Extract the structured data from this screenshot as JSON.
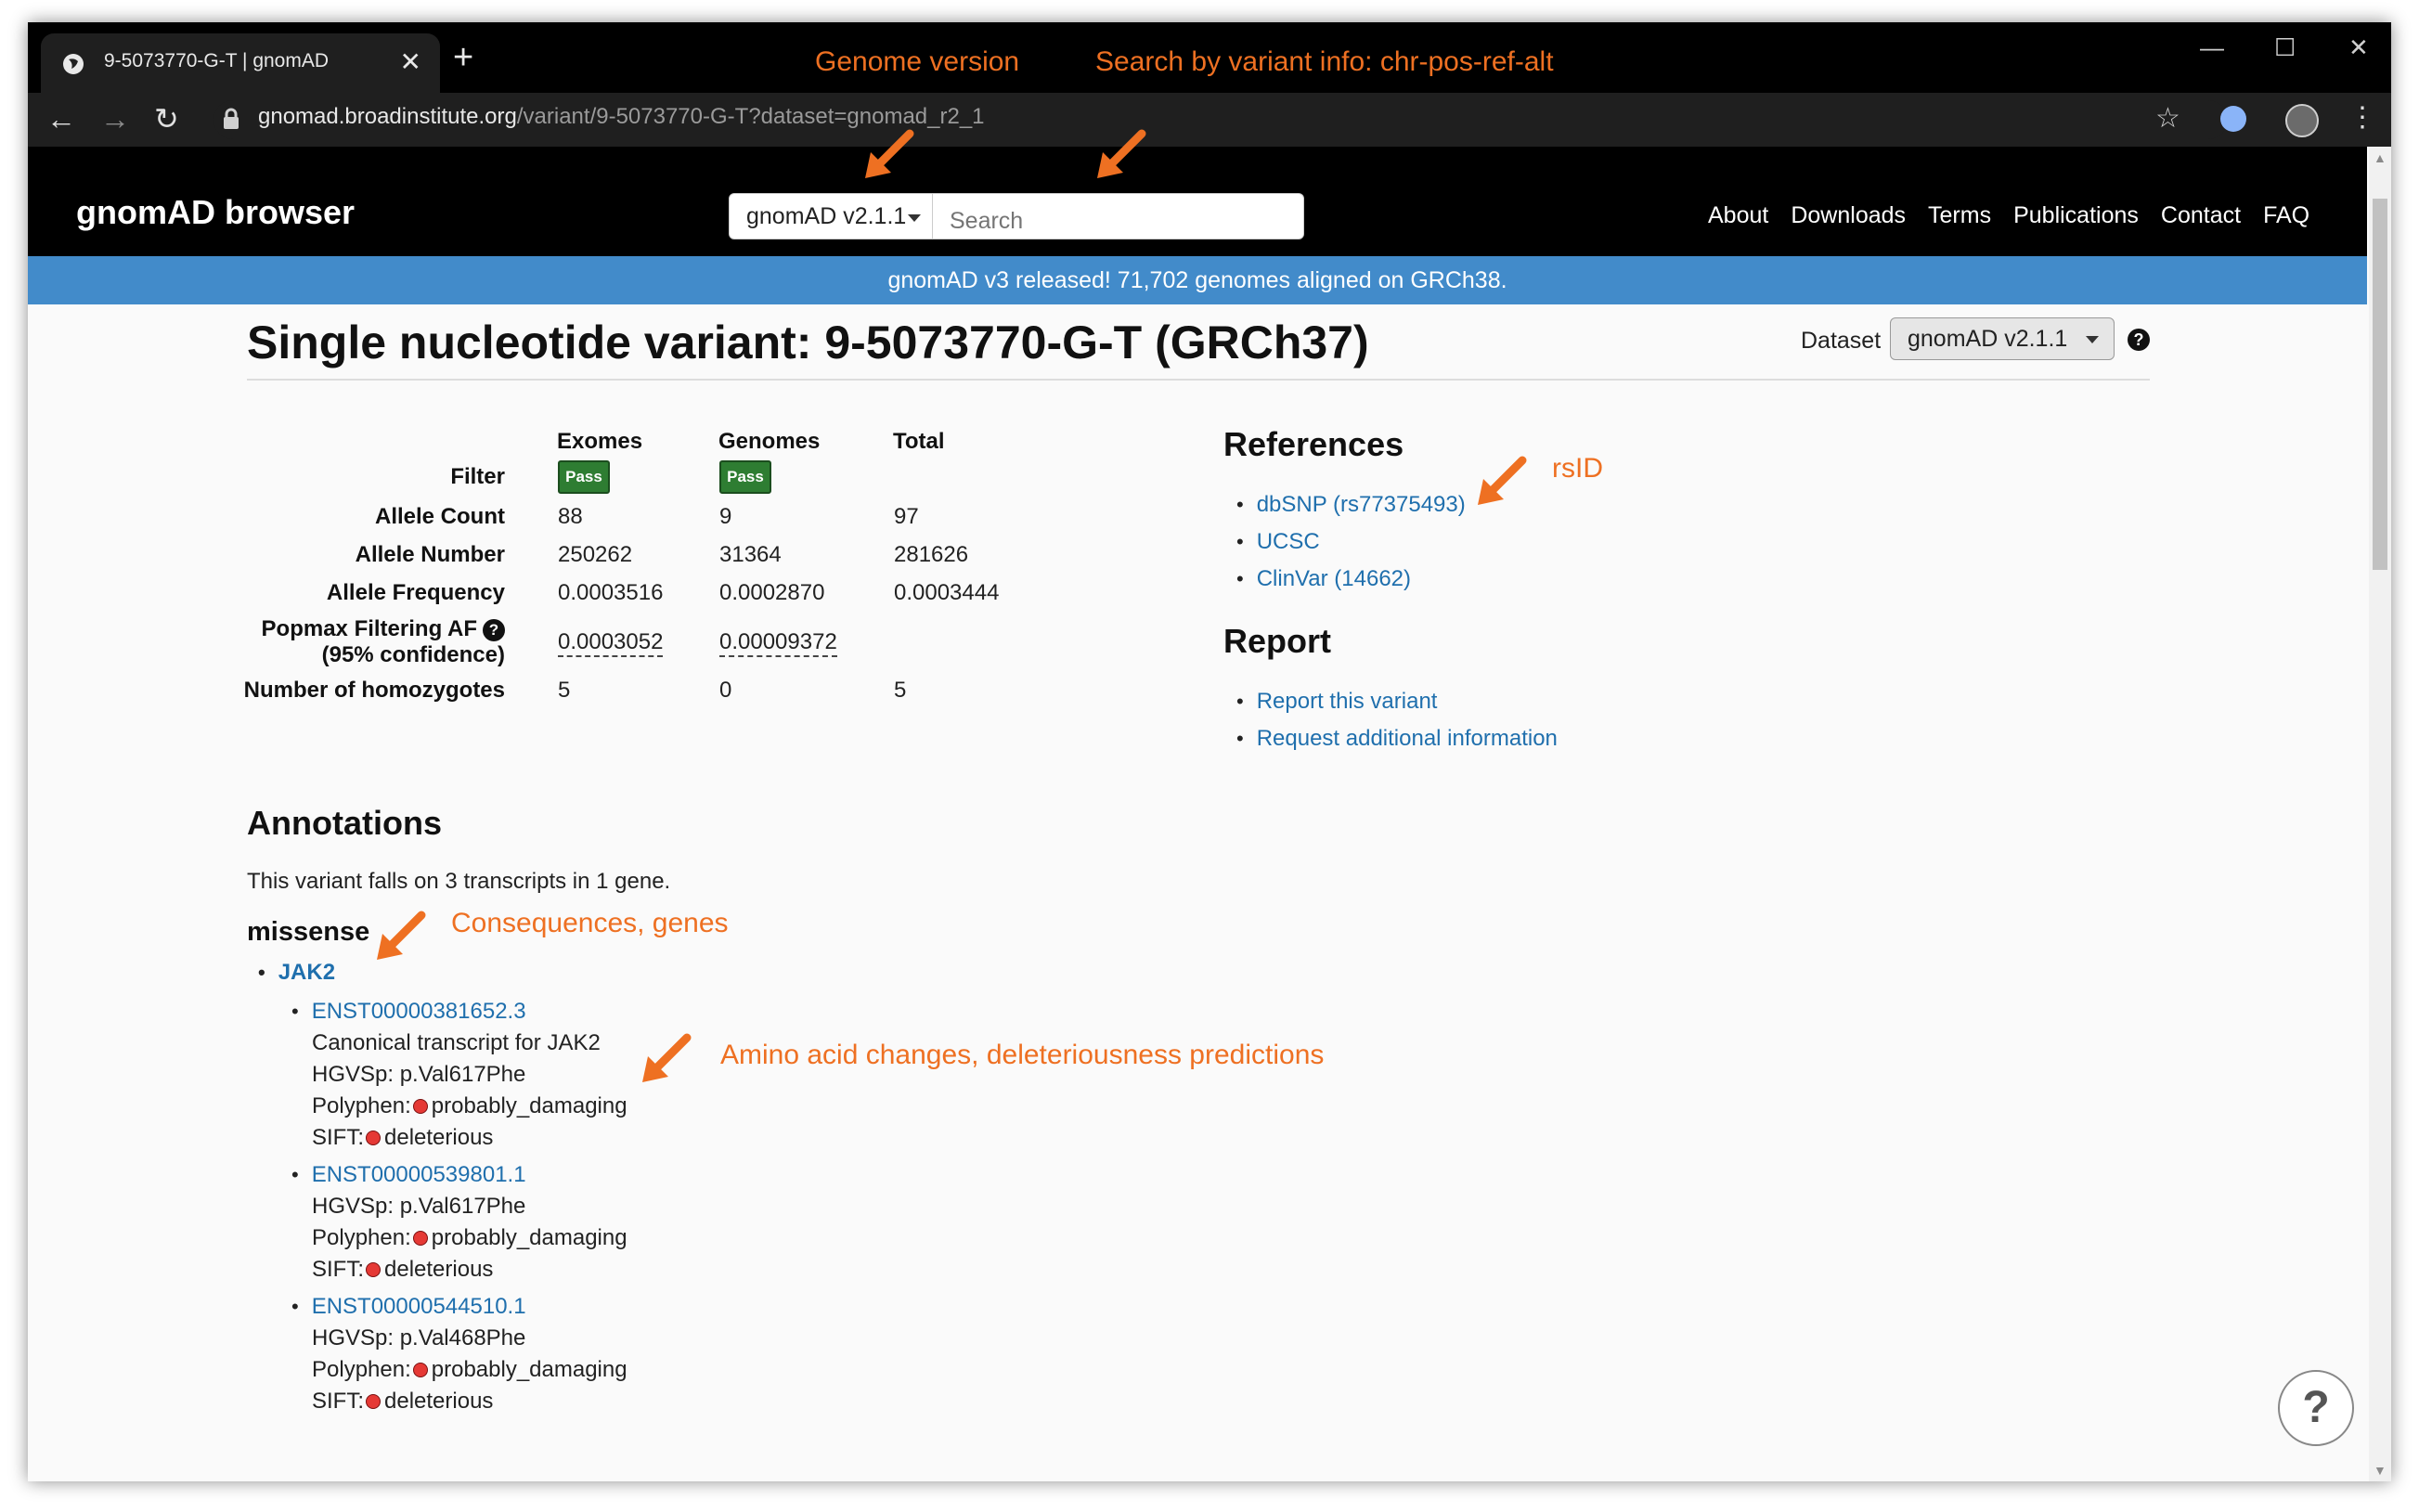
{
  "browser": {
    "tab_title": "9-5073770-G-T | gnomAD",
    "url_host": "gnomad.broadinstitute.org",
    "url_path": "/variant/9-5073770-G-T?dataset=gnomad_r2_1"
  },
  "annotations": {
    "genome_version": "Genome version",
    "search_by": "Search by variant info: chr-pos-ref-alt",
    "rsid": "rsID",
    "consequences": "Consequences, genes",
    "amino_acid": "Amino acid changes, deleteriousness predictions"
  },
  "header": {
    "brand": "gnomAD browser",
    "version_select": "gnomAD v2.1.1",
    "search_placeholder": "Search",
    "nav": [
      "About",
      "Downloads",
      "Terms",
      "Publications",
      "Contact",
      "FAQ"
    ]
  },
  "banner": "gnomAD v3 released! 71,702 genomes aligned on GRCh38.",
  "page": {
    "title": "Single nucleotide variant: 9-5073770-G-T (GRCh37)",
    "dataset_label": "Dataset",
    "dataset_value": "gnomAD v2.1.1"
  },
  "freq_table": {
    "columns": [
      "Exomes",
      "Genomes",
      "Total"
    ],
    "filter_label": "Filter",
    "pass_label": "Pass",
    "rows": [
      {
        "label": "Allele Count",
        "values": [
          "88",
          "9",
          "97"
        ]
      },
      {
        "label": "Allele Number",
        "values": [
          "250262",
          "31364",
          "281626"
        ]
      },
      {
        "label": "Allele Frequency",
        "values": [
          "0.0003516",
          "0.0002870",
          "0.0003444"
        ]
      }
    ],
    "popmax_label": "Popmax Filtering AF",
    "popmax_sub": "(95% confidence)",
    "popmax_values": [
      "0.0003052",
      "0.00009372"
    ],
    "homozygotes_label": "Number of homozygotes",
    "homozygotes_values": [
      "5",
      "0",
      "5"
    ]
  },
  "references": {
    "heading": "References",
    "links": [
      "dbSNP (rs77375493)",
      "UCSC",
      "ClinVar (14662)"
    ]
  },
  "report": {
    "heading": "Report",
    "links": [
      "Report this variant",
      "Request additional information"
    ]
  },
  "annotations_section": {
    "heading": "Annotations",
    "summary": "This variant falls on 3 transcripts in 1 gene.",
    "consequence": "missense",
    "gene": "JAK2",
    "transcripts": [
      {
        "id": "ENST00000381652.3",
        "note": "Canonical transcript for JAK2",
        "hgvsp": "HGVSp: p.Val617Phe",
        "polyphen_label": "Polyphen:",
        "polyphen": "probably_damaging",
        "sift_label": "SIFT:",
        "sift": "deleterious"
      },
      {
        "id": "ENST00000539801.1",
        "hgvsp": "HGVSp: p.Val617Phe",
        "polyphen_label": "Polyphen:",
        "polyphen": "probably_damaging",
        "sift_label": "SIFT:",
        "sift": "deleterious"
      },
      {
        "id": "ENST00000544510.1",
        "hgvsp": "HGVSp: p.Val468Phe",
        "polyphen_label": "Polyphen:",
        "polyphen": "probably_damaging",
        "sift_label": "SIFT:",
        "sift": "deleterious"
      }
    ]
  },
  "help_button": "?",
  "colors": {
    "annotation": "#ee7022",
    "banner": "#428bca",
    "link": "#1f6fad",
    "pass": "#2e7d32",
    "danger_dot": "#e53935"
  }
}
